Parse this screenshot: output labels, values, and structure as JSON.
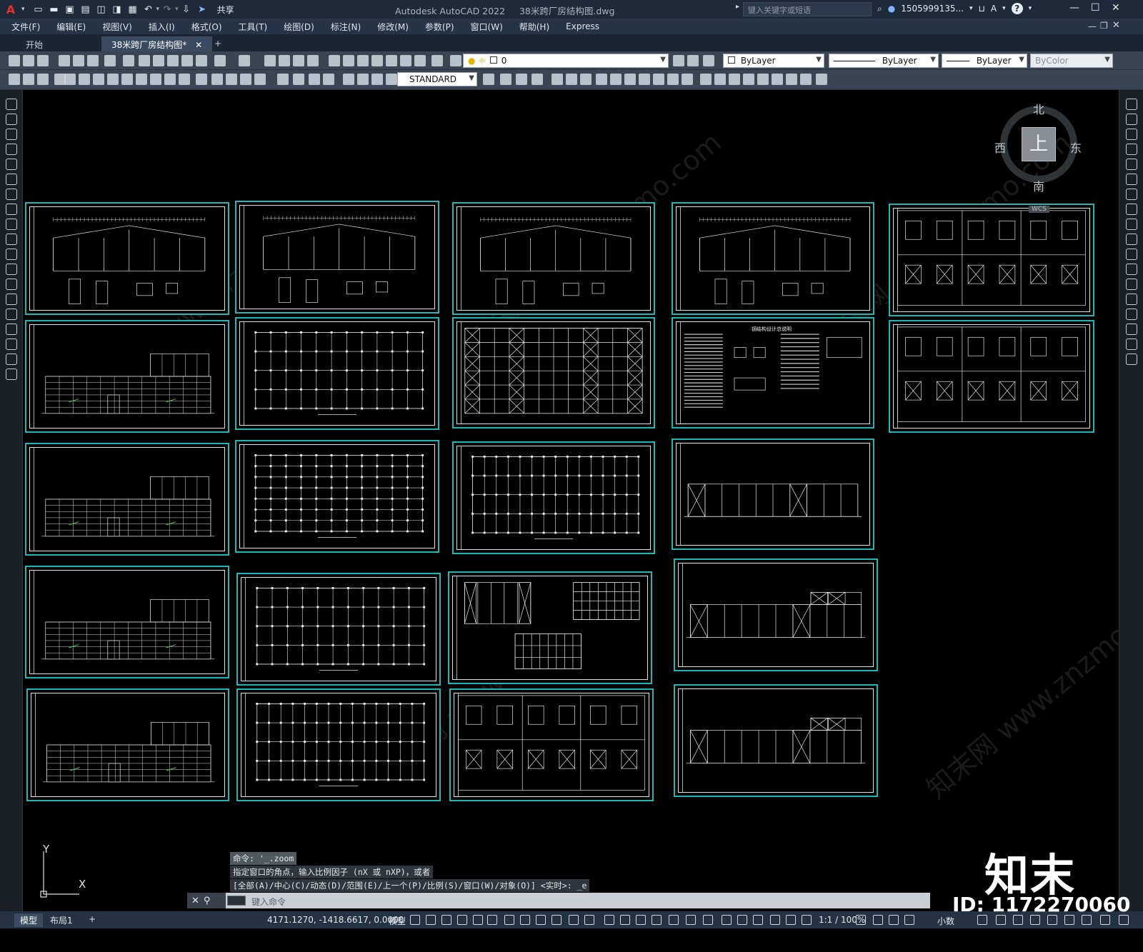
{
  "titlebar": {
    "logo": "A",
    "share_label": "共享",
    "app_title": "Autodesk AutoCAD 2022",
    "file_name": "38米跨厂房结构图.dwg",
    "search_placeholder": "键入关键字或短语",
    "user": "1505999135...",
    "help_icon": "?"
  },
  "menu": [
    "文件(F)",
    "编辑(E)",
    "视图(V)",
    "插入(I)",
    "格式(O)",
    "工具(T)",
    "绘图(D)",
    "标注(N)",
    "修改(M)",
    "参数(P)",
    "窗口(W)",
    "帮助(H)",
    "Express"
  ],
  "tabs": {
    "start": "开始",
    "drawing": "38米跨厂房结构图*",
    "add": "+"
  },
  "toolbar1": {
    "layer_value": "0",
    "color_value": "ByLayer",
    "linetype_value": "ByLayer",
    "lineweight_value": "ByLayer",
    "plotstyle_value": "ByColor"
  },
  "toolbar2": {
    "text_style": "STANDARD"
  },
  "viewcube": {
    "north": "北",
    "south": "南",
    "east": "东",
    "west": "西",
    "face": "上",
    "wcs": "WCS"
  },
  "commandline": {
    "history1": "命令: '_.zoom",
    "history2": "指定窗口的角点，输入比例因子 (nX 或 nXP)，或者",
    "history3": "[全部(A)/中心(C)/动态(D)/范围(E)/上一个(P)/比例(S)/窗口(W)/对象(O)] <实时>: _e",
    "placeholder": "键入命令"
  },
  "ucs": {
    "x": "X",
    "y": "Y"
  },
  "statusbar": {
    "model_tab": "模型",
    "layout_tab": "布局1",
    "add": "+",
    "coordinates": "4171.1270, -1418.6617, 0.0000",
    "model_label": "模型",
    "scale": "1:1 / 100%",
    "units": "小数"
  },
  "watermark": {
    "logo": "知末",
    "id": "ID: 1172270060",
    "diagonal": "知末网 www.znzmo.com"
  },
  "drawing_title": "钢结构设计总说明",
  "colors": {
    "sheet_border": "#1fb7b5",
    "canvas": "#000000",
    "titlebar": "#1e2a3a"
  }
}
